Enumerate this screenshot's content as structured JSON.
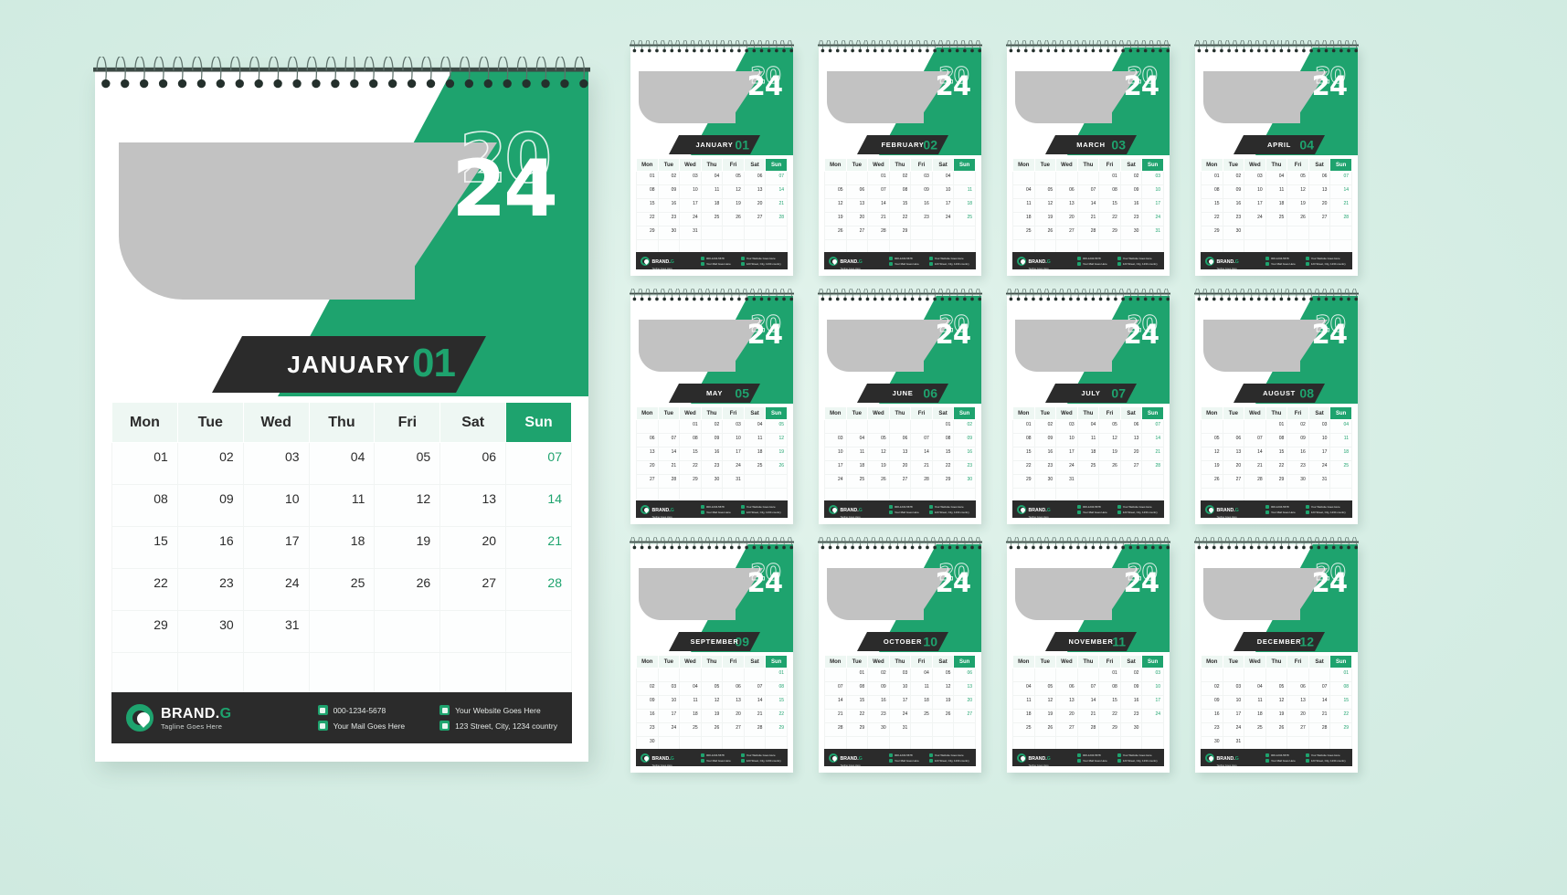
{
  "theme": {
    "background": "#d7eee5",
    "accent_green": "#1ea36e",
    "dark": "#2b2b2b",
    "photo_placeholder": "#c2c2c2",
    "header_row": "#eef7f3"
  },
  "year": {
    "top": "20",
    "bottom": "24",
    "full": "2024"
  },
  "weekdays": [
    "Mon",
    "Tue",
    "Wed",
    "Thu",
    "Fri",
    "Sat",
    "Sun"
  ],
  "brand": {
    "name": "BRAND.",
    "name_accent": "G",
    "tagline": "Tagline Goes Here",
    "logo_icon": "brand-circle-pin-icon"
  },
  "contacts": [
    {
      "icon": "phone-icon",
      "text": "000-1234-5678"
    },
    {
      "icon": "mail-icon",
      "text": "Your Mail Goes Here"
    },
    {
      "icon": "globe-icon",
      "text": "Your Website Goes Here"
    },
    {
      "icon": "location-icon",
      "text": "123 Street, City, 1234 country"
    }
  ],
  "main": {
    "month": "JANUARY",
    "month_number": "01",
    "weeks": [
      [
        "01",
        "02",
        "03",
        "04",
        "05",
        "06",
        "07"
      ],
      [
        "08",
        "09",
        "10",
        "11",
        "12",
        "13",
        "14"
      ],
      [
        "15",
        "16",
        "17",
        "18",
        "19",
        "20",
        "21"
      ],
      [
        "22",
        "23",
        "24",
        "25",
        "26",
        "27",
        "28"
      ],
      [
        "29",
        "30",
        "31",
        "",
        "",
        "",
        ""
      ],
      [
        "",
        "",
        "",
        "",
        "",
        "",
        ""
      ]
    ]
  },
  "months": [
    {
      "name": "JANUARY",
      "number": "01",
      "weeks": [
        [
          "01",
          "02",
          "03",
          "04",
          "05",
          "06",
          "07"
        ],
        [
          "08",
          "09",
          "10",
          "11",
          "12",
          "13",
          "14"
        ],
        [
          "15",
          "16",
          "17",
          "18",
          "19",
          "20",
          "21"
        ],
        [
          "22",
          "23",
          "24",
          "25",
          "26",
          "27",
          "28"
        ],
        [
          "29",
          "30",
          "31",
          "",
          "",
          "",
          ""
        ],
        [
          "",
          "",
          "",
          "",
          "",
          "",
          ""
        ]
      ]
    },
    {
      "name": "FEBRUARY",
      "number": "02",
      "weeks": [
        [
          "",
          "",
          "01",
          "02",
          "03",
          "04",
          ""
        ],
        [
          "05",
          "06",
          "07",
          "08",
          "09",
          "10",
          "11"
        ],
        [
          "12",
          "13",
          "14",
          "15",
          "16",
          "17",
          "18"
        ],
        [
          "19",
          "20",
          "21",
          "22",
          "23",
          "24",
          "25"
        ],
        [
          "26",
          "27",
          "28",
          "29",
          "",
          "",
          ""
        ],
        [
          "",
          "",
          "",
          "",
          "",
          "",
          ""
        ]
      ]
    },
    {
      "name": "MARCH",
      "number": "03",
      "weeks": [
        [
          "",
          "",
          "",
          "",
          "01",
          "02",
          "03"
        ],
        [
          "04",
          "05",
          "06",
          "07",
          "08",
          "09",
          "10"
        ],
        [
          "11",
          "12",
          "13",
          "14",
          "15",
          "16",
          "17"
        ],
        [
          "18",
          "19",
          "20",
          "21",
          "22",
          "23",
          "24"
        ],
        [
          "25",
          "26",
          "27",
          "28",
          "29",
          "30",
          "31"
        ],
        [
          "",
          "",
          "",
          "",
          "",
          "",
          ""
        ]
      ]
    },
    {
      "name": "APRIL",
      "number": "04",
      "weeks": [
        [
          "01",
          "02",
          "03",
          "04",
          "05",
          "06",
          "07"
        ],
        [
          "08",
          "09",
          "10",
          "11",
          "12",
          "13",
          "14"
        ],
        [
          "15",
          "16",
          "17",
          "18",
          "19",
          "20",
          "21"
        ],
        [
          "22",
          "23",
          "24",
          "25",
          "26",
          "27",
          "28"
        ],
        [
          "29",
          "30",
          "",
          "",
          "",
          "",
          ""
        ],
        [
          "",
          "",
          "",
          "",
          "",
          "",
          ""
        ]
      ]
    },
    {
      "name": "MAY",
      "number": "05",
      "weeks": [
        [
          "",
          "",
          "01",
          "02",
          "03",
          "04",
          "05"
        ],
        [
          "06",
          "07",
          "08",
          "09",
          "10",
          "11",
          "12"
        ],
        [
          "13",
          "14",
          "15",
          "16",
          "17",
          "18",
          "19"
        ],
        [
          "20",
          "21",
          "22",
          "23",
          "24",
          "25",
          "26"
        ],
        [
          "27",
          "28",
          "29",
          "30",
          "31",
          "",
          ""
        ],
        [
          "",
          "",
          "",
          "",
          "",
          "",
          ""
        ]
      ]
    },
    {
      "name": "JUNE",
      "number": "06",
      "weeks": [
        [
          "",
          "",
          "",
          "",
          "",
          "01",
          "02"
        ],
        [
          "03",
          "04",
          "05",
          "06",
          "07",
          "08",
          "09"
        ],
        [
          "10",
          "11",
          "12",
          "13",
          "14",
          "15",
          "16"
        ],
        [
          "17",
          "18",
          "19",
          "20",
          "21",
          "22",
          "23"
        ],
        [
          "24",
          "25",
          "26",
          "27",
          "28",
          "29",
          "30"
        ],
        [
          "",
          "",
          "",
          "",
          "",
          "",
          ""
        ]
      ]
    },
    {
      "name": "JULY",
      "number": "07",
      "weeks": [
        [
          "01",
          "02",
          "03",
          "04",
          "05",
          "06",
          "07"
        ],
        [
          "08",
          "09",
          "10",
          "11",
          "12",
          "13",
          "14"
        ],
        [
          "15",
          "16",
          "17",
          "18",
          "19",
          "20",
          "21"
        ],
        [
          "22",
          "23",
          "24",
          "25",
          "26",
          "27",
          "28"
        ],
        [
          "29",
          "30",
          "31",
          "",
          "",
          "",
          ""
        ],
        [
          "",
          "",
          "",
          "",
          "",
          "",
          ""
        ]
      ]
    },
    {
      "name": "AUGUST",
      "number": "08",
      "weeks": [
        [
          "",
          "",
          "",
          "01",
          "02",
          "03",
          "04"
        ],
        [
          "05",
          "06",
          "07",
          "08",
          "09",
          "10",
          "11"
        ],
        [
          "12",
          "13",
          "14",
          "15",
          "16",
          "17",
          "18"
        ],
        [
          "19",
          "20",
          "21",
          "22",
          "23",
          "24",
          "25"
        ],
        [
          "26",
          "27",
          "28",
          "29",
          "30",
          "31",
          ""
        ],
        [
          "",
          "",
          "",
          "",
          "",
          "",
          ""
        ]
      ]
    },
    {
      "name": "SEPTEMBER",
      "number": "09",
      "weeks": [
        [
          "",
          "",
          "",
          "",
          "",
          "",
          "01"
        ],
        [
          "02",
          "03",
          "04",
          "05",
          "06",
          "07",
          "08"
        ],
        [
          "09",
          "10",
          "11",
          "12",
          "13",
          "14",
          "15"
        ],
        [
          "16",
          "17",
          "18",
          "19",
          "20",
          "21",
          "22"
        ],
        [
          "23",
          "24",
          "25",
          "26",
          "27",
          "28",
          "29"
        ],
        [
          "30",
          "",
          "",
          "",
          "",
          "",
          ""
        ]
      ]
    },
    {
      "name": "OCTOBER",
      "number": "10",
      "weeks": [
        [
          "",
          "01",
          "02",
          "03",
          "04",
          "05",
          "06"
        ],
        [
          "07",
          "08",
          "09",
          "10",
          "11",
          "12",
          "13"
        ],
        [
          "14",
          "15",
          "16",
          "17",
          "18",
          "19",
          "20"
        ],
        [
          "21",
          "22",
          "23",
          "24",
          "25",
          "26",
          "27"
        ],
        [
          "28",
          "29",
          "30",
          "31",
          "",
          "",
          ""
        ],
        [
          "",
          "",
          "",
          "",
          "",
          "",
          ""
        ]
      ]
    },
    {
      "name": "NOVEMBER",
      "number": "11",
      "weeks": [
        [
          "",
          "",
          "",
          "",
          "01",
          "02",
          "03"
        ],
        [
          "04",
          "05",
          "06",
          "07",
          "08",
          "09",
          "10"
        ],
        [
          "11",
          "12",
          "13",
          "14",
          "15",
          "16",
          "17"
        ],
        [
          "18",
          "19",
          "20",
          "21",
          "22",
          "23",
          "24"
        ],
        [
          "25",
          "26",
          "27",
          "28",
          "29",
          "30",
          ""
        ],
        [
          "",
          "",
          "",
          "",
          "",
          "",
          ""
        ]
      ]
    },
    {
      "name": "DECEMBER",
      "number": "12",
      "weeks": [
        [
          "",
          "",
          "",
          "",
          "",
          "",
          "01"
        ],
        [
          "02",
          "03",
          "04",
          "05",
          "06",
          "07",
          "08"
        ],
        [
          "09",
          "10",
          "11",
          "12",
          "13",
          "14",
          "15"
        ],
        [
          "16",
          "17",
          "18",
          "19",
          "20",
          "21",
          "22"
        ],
        [
          "23",
          "24",
          "25",
          "26",
          "27",
          "28",
          "29"
        ],
        [
          "30",
          "31",
          "",
          "",
          "",
          "",
          ""
        ]
      ]
    }
  ]
}
